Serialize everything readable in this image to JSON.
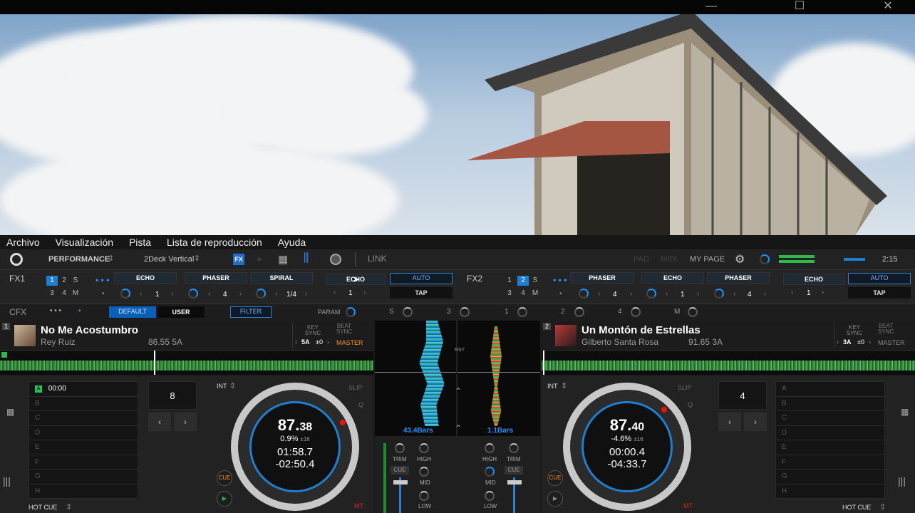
{
  "window": {
    "minimize": "—",
    "maximize": "☐",
    "close": "✕"
  },
  "menu": [
    "Archivo",
    "Visualización",
    "Pista",
    "Lista de reproducción",
    "Ayuda"
  ],
  "toolbar": {
    "layout": "PERFORMANCE",
    "deck_mode": "2Deck Vertical",
    "link": "LINK",
    "pad": "PAD",
    "midi": "MIDI",
    "my_page": "MY PAGE",
    "time": "2:15"
  },
  "fx1": {
    "label": "FX1",
    "assign": [
      "1",
      "2",
      "S",
      "3",
      "4",
      "M"
    ],
    "dots": "• • •",
    "effects": [
      "ECHO",
      "PHASER",
      "SPIRAL",
      "ECHO"
    ],
    "values": [
      "1",
      "4",
      "1/4",
      "1"
    ],
    "auto": "AUTO",
    "tap": "TAP"
  },
  "fx2": {
    "label": "FX2",
    "assign": [
      "1",
      "2",
      "S",
      "3",
      "4",
      "M"
    ],
    "dots": "• • •",
    "effects": [
      "PHASER",
      "ECHO",
      "PHASER",
      "ECHO"
    ],
    "values": [
      "4",
      "1",
      "4",
      "1"
    ],
    "auto": "AUTO",
    "tap": "TAP"
  },
  "cfx": {
    "label": "CFX",
    "dots": "• • •",
    "default": "DEFAULT",
    "user": "USER",
    "filter": "FILTER",
    "param": "PARAM",
    "slots": [
      "S",
      "3",
      "1",
      "2",
      "4",
      "M"
    ]
  },
  "deck1": {
    "num": "1",
    "title": "No Me Acostumbro",
    "artist": "Rey Ruiz",
    "bpm_key": "86.55 5A",
    "key_sync": "KEY SYNC",
    "key": "5A",
    "key_off": "±0",
    "beat_sync": "BEAT SYNC",
    "master": "MASTER",
    "hotcue_time": "00:00",
    "cue_letters": [
      "B",
      "C",
      "D",
      "E",
      "F",
      "G",
      "H"
    ],
    "loop": "8",
    "int": "INT",
    "slip": "SLIP",
    "q": "Q",
    "bpm_int": "87.",
    "bpm_dec": "38",
    "pitch": "0.9%",
    "range": "±16",
    "elapsed": "01:58.7",
    "remain": "-02:50.4",
    "cue": "CUE",
    "mt": "MT",
    "hot_cue": "HOT CUE",
    "hotcue_a": "A"
  },
  "deck2": {
    "num": "2",
    "title": "Un Montón de Estrellas",
    "artist": "Gilberto Santa Rosa",
    "bpm_key": "91.65 3A",
    "key_sync": "KEY SYNC",
    "key": "3A",
    "key_off": "±0",
    "beat_sync": "BEAT SYNC",
    "master": "MASTER",
    "cue_letters": [
      "A",
      "B",
      "C",
      "D",
      "E",
      "F",
      "G",
      "H"
    ],
    "loop": "4",
    "int": "INT",
    "slip": "SLIP",
    "q": "Q",
    "bpm_int": "87.",
    "bpm_dec": "40",
    "pitch": "-4.6%",
    "range": "±16",
    "elapsed": "00:00.4",
    "remain": "-04:33.7",
    "cue": "CUE",
    "mt": "MT",
    "hot_cue": "HOT CUE"
  },
  "center": {
    "bars_left": "43.4Bars",
    "bars_right": "1.1Bars",
    "rst": "RST"
  },
  "mixer": {
    "trim": "TRIM",
    "high": "HIGH",
    "mid": "MID",
    "low": "LOW",
    "cue": "CUE"
  },
  "colors": {
    "accent": "#1e90ff",
    "green": "#4caf50",
    "master": "#ff8c1a",
    "hotcue": "#22c55e"
  }
}
